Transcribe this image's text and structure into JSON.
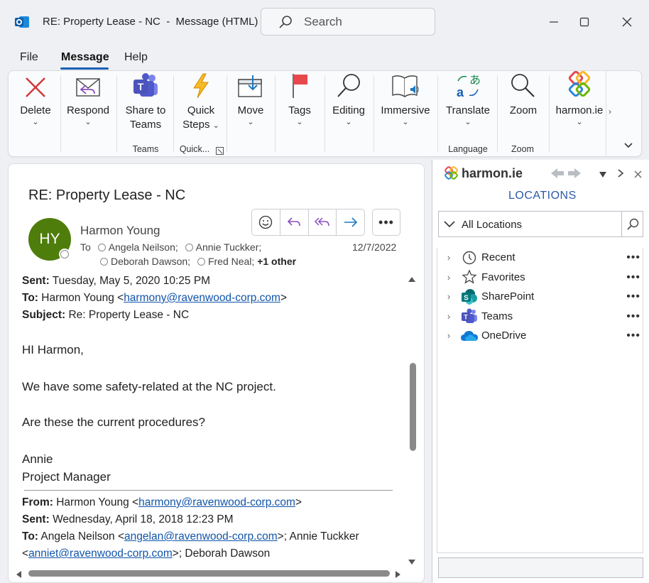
{
  "window": {
    "title": "RE: Property Lease - NC  -  Message (HTML)",
    "search_placeholder": "Search"
  },
  "menu": {
    "file": "File",
    "message": "Message",
    "help": "Help"
  },
  "ribbon": {
    "delete": "Delete",
    "respond": "Respond",
    "share_line1": "Share to",
    "share_line2": "Teams",
    "quick_line1": "Quick",
    "quick_line2": "Steps",
    "move": "Move",
    "tags": "Tags",
    "editing": "Editing",
    "immersive": "Immersive",
    "translate": "Translate",
    "zoom": "Zoom",
    "harmon": "harmon.ie",
    "groups": {
      "teams": "Teams",
      "quick": "Quick...",
      "language": "Language",
      "zoom": "Zoom"
    }
  },
  "message": {
    "subject": "RE: Property Lease - NC",
    "avatar_initials": "HY",
    "sender": "Harmon Young",
    "to_label": "To",
    "recipients": [
      "Angela Neilson;",
      "Annie Tuckker;",
      "Deborah Dawson;",
      "Fred Neal;"
    ],
    "more_recipients": "+1 other",
    "date": "12/7/2022"
  },
  "body": {
    "sent_label": "Sent:",
    "sent_value": "Tuesday, May 5, 2020 10:25 PM",
    "to_label": "To:",
    "to_name": "Harmon Young <",
    "to_email": "harmony@ravenwood-corp.com",
    "to_close": ">",
    "subject_label": "Subject:",
    "subject_value": "Re: Property Lease - NC",
    "greeting": "HI Harmon,",
    "p1": "We have some safety-related at the NC project.",
    "p2": "Are these the current procedures?",
    "sig_name": "Annie",
    "sig_title": "Project Manager",
    "q_from_label": "From:",
    "q_from_name": "Harmon Young <",
    "q_from_email": "harmony@ravenwood-corp.com",
    "q_from_close": ">",
    "q_sent_label": "Sent:",
    "q_sent_value": "Wednesday, April 18, 2018 12:23 PM",
    "q_to_label": "To:",
    "q_to_1": "Angela Neilson <",
    "q_to_1_email": "angelan@ravenwood-corp.com",
    "q_to_1_close": ">; Annie Tuckker",
    "q_to_2_open": "<",
    "q_to_2_email": "anniet@ravenwood-corp.com",
    "q_to_2_close": ">; Deborah Dawson"
  },
  "harmonie": {
    "brand": "harmon.ie",
    "locations_title": "LOCATIONS",
    "all_locations": "All Locations",
    "items": [
      "Recent",
      "Favorites",
      "SharePoint",
      "Teams",
      "OneDrive"
    ]
  },
  "colors": {
    "accent": "#1a5fb4",
    "avatar_bg": "#4e7d0c",
    "link": "#1155aa",
    "delete_red": "#d13438",
    "locations_blue": "#2b5aa8"
  }
}
